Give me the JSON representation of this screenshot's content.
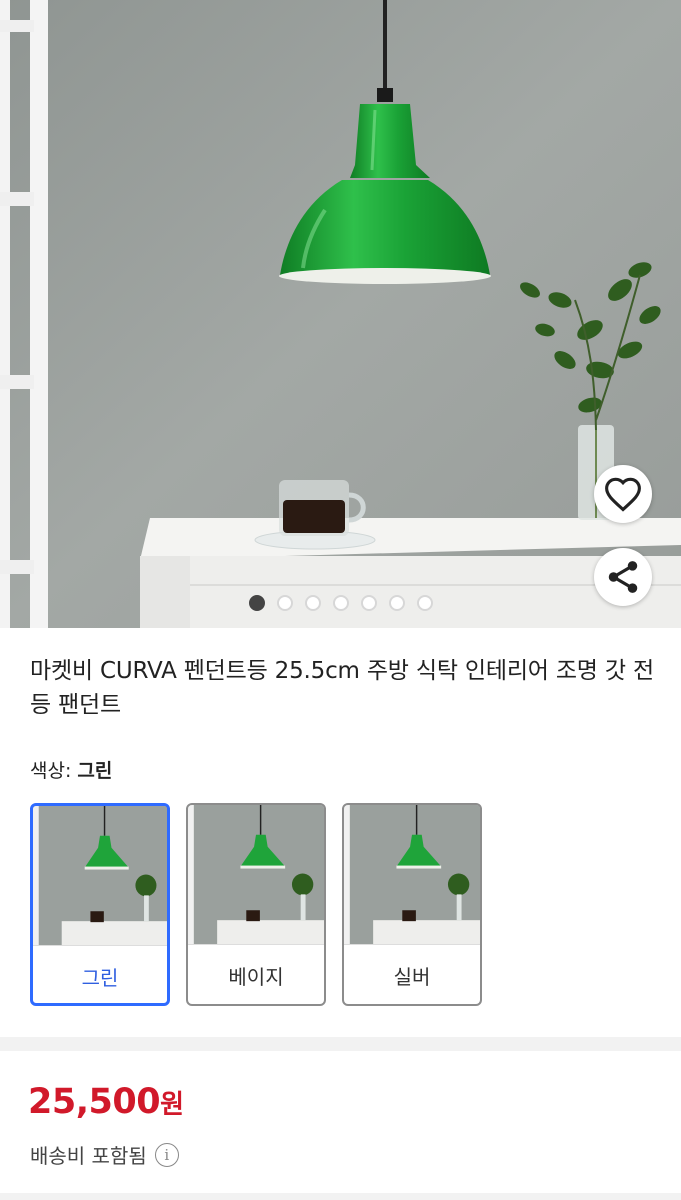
{
  "product": {
    "image_alt": "Green pendant lamp above a white table with coffee cup and plant",
    "title": "마켓비 CURVA 펜던트등 25.5cm 주방 식탁 인테리어 조명 갓 전등 팬던트",
    "carousel": {
      "total": 7,
      "current": 1
    }
  },
  "actions": {
    "wishlist_icon": "heart-outline-icon",
    "share_icon": "share-icon"
  },
  "color_selector": {
    "label": "색상: ",
    "selected": "그린",
    "options": [
      {
        "label": "그린",
        "selected": true
      },
      {
        "label": "베이지",
        "selected": false
      },
      {
        "label": "실버",
        "selected": false
      }
    ]
  },
  "pricing": {
    "amount": "25,500",
    "currency": "원",
    "shipping": "배송비 포함됨",
    "shipping_info_icon": "info-icon"
  },
  "colors": {
    "lamp_green": "#1fa43a",
    "price_red": "#d1192a",
    "selected_blue": "#2f6bff"
  }
}
